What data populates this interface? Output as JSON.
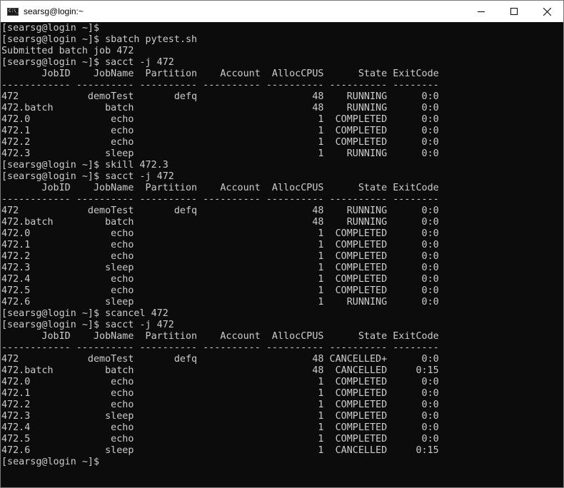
{
  "window": {
    "title": "searsg@login:~",
    "icon": "console-icon",
    "controls": [
      "minimize-icon",
      "maximize-icon",
      "close-icon"
    ]
  },
  "prompt": "[searsg@login ~]$",
  "terminal": {
    "lines": [
      "[searsg@login ~]$",
      "[searsg@login ~]$ sbatch pytest.sh",
      "Submitted batch job 472",
      "[searsg@login ~]$ sacct -j 472",
      "       JobID    JobName  Partition    Account  AllocCPUS      State ExitCode",
      "------------ ---------- ---------- ---------- ---------- ---------- --------",
      "472            demoTest       defq                    48    RUNNING      0:0",
      "472.batch         batch                               48    RUNNING      0:0",
      "472.0              echo                                1  COMPLETED      0:0",
      "472.1              echo                                1  COMPLETED      0:0",
      "472.2              echo                                1  COMPLETED      0:0",
      "472.3             sleep                                1    RUNNING      0:0",
      "[searsg@login ~]$ skill 472.3",
      "[searsg@login ~]$ sacct -j 472",
      "       JobID    JobName  Partition    Account  AllocCPUS      State ExitCode",
      "------------ ---------- ---------- ---------- ---------- ---------- --------",
      "472            demoTest       defq                    48    RUNNING      0:0",
      "472.batch         batch                               48    RUNNING      0:0",
      "472.0              echo                                1  COMPLETED      0:0",
      "472.1              echo                                1  COMPLETED      0:0",
      "472.2              echo                                1  COMPLETED      0:0",
      "472.3             sleep                                1  COMPLETED      0:0",
      "472.4              echo                                1  COMPLETED      0:0",
      "472.5              echo                                1  COMPLETED      0:0",
      "472.6             sleep                                1    RUNNING      0:0",
      "[searsg@login ~]$ scancel 472",
      "[searsg@login ~]$ sacct -j 472",
      "       JobID    JobName  Partition    Account  AllocCPUS      State ExitCode",
      "------------ ---------- ---------- ---------- ---------- ---------- --------",
      "472            demoTest       defq                    48 CANCELLED+      0:0",
      "472.batch         batch                               48  CANCELLED     0:15",
      "472.0              echo                                1  COMPLETED      0:0",
      "472.1              echo                                1  COMPLETED      0:0",
      "472.2              echo                                1  COMPLETED      0:0",
      "472.3             sleep                                1  COMPLETED      0:0",
      "472.4              echo                                1  COMPLETED      0:0",
      "472.5              echo                                1  COMPLETED      0:0",
      "472.6             sleep                                1  CANCELLED     0:15",
      "[searsg@login ~]$"
    ]
  },
  "colors": {
    "terminal_bg": "#0c0c0c",
    "terminal_fg": "#cccccc",
    "titlebar_bg": "#ffffff"
  }
}
